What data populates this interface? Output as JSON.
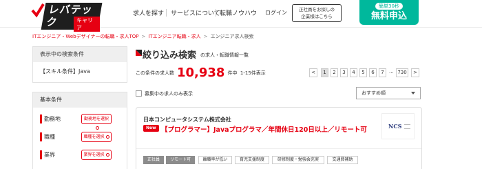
{
  "header": {
    "logo_text": "レバテック",
    "logo_sub": "キャリア",
    "nav": [
      "求人を探す",
      "サービスについて",
      "転職ノウハウ"
    ],
    "login": "ログイン",
    "corp_btn_line1": "正社員をお探しの",
    "corp_btn_line2": "企業様はこちら",
    "apply_sub": "簡単30秒",
    "apply_main": "無料申込"
  },
  "breadcrumb": {
    "items": [
      "ITエンジニア・Webデザイナーの転職・求人TOP",
      "ITエンジニア転職・求人",
      "エンジニア求人検索"
    ],
    "separator": ">"
  },
  "sidebar": {
    "current_head": "表示中の検索条件",
    "current_value": "【スキル条件】Java",
    "basic_head": "基本条件",
    "conditions": [
      {
        "label": "勤務地",
        "button": "勤務地を選択"
      },
      {
        "label": "職種",
        "button": "職種を選択"
      },
      {
        "label": "業界",
        "button": "業界を選択"
      }
    ]
  },
  "main": {
    "title": "絞り込み検索",
    "title_sub": "の求人・転職情報一覧",
    "count_prefix": "この条件の求人数",
    "count": "10,938",
    "count_suffix": "件中",
    "range": "1-15件表示",
    "pager": [
      "<",
      "1",
      "2",
      "3",
      "4",
      "5",
      "6",
      "7",
      "...",
      "730",
      ">"
    ],
    "filter_checkbox": "募集中の求人のみ表示",
    "sort": "おすすめ順"
  },
  "job": {
    "company": "日本コンピュータシステム株式会社",
    "new_badge": "New",
    "title": "【プログラマー】Javaプログラマ／年間休日120日以上／リモート可",
    "logo_text": "NCS",
    "tags": [
      "正社員",
      "リモート可",
      "離職率が低い",
      "育児支援制度",
      "研修制度・勉強会充実",
      "交通費補助"
    ]
  },
  "colors": {
    "brand_red": "#e60012",
    "apply_green": "#00b89c",
    "tag_dark": "#8c8c8c"
  }
}
